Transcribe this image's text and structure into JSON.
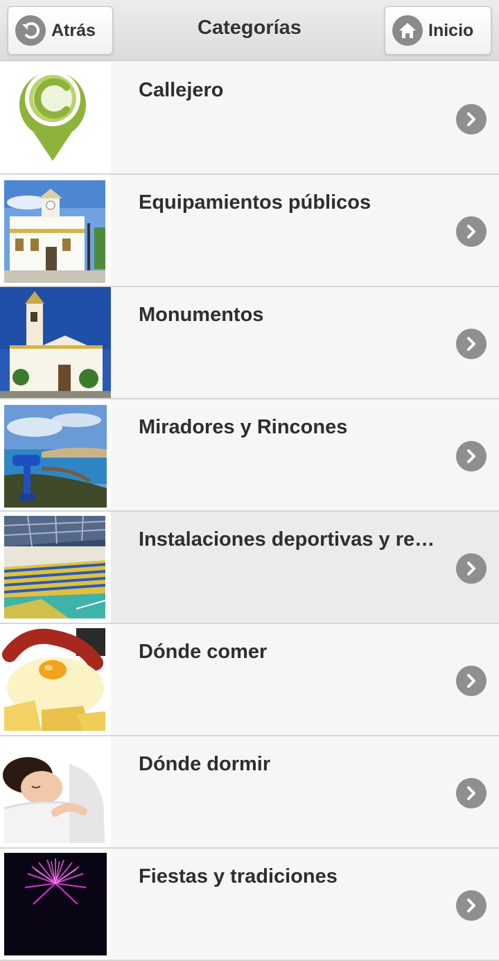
{
  "header": {
    "title": "Categorías",
    "back_label": "Atrás",
    "home_label": "Inicio"
  },
  "categories": [
    {
      "label": "Callejero",
      "thumb": "map-pin-c-logo"
    },
    {
      "label": "Equipamientos públicos",
      "thumb": "town-hall-photo"
    },
    {
      "label": "Monumentos",
      "thumb": "church-tower-photo"
    },
    {
      "label": "Miradores y Rincones",
      "thumb": "viewpoint-telescope-photo"
    },
    {
      "label": "Instalaciones deportivas y re…",
      "thumb": "sports-hall-photo"
    },
    {
      "label": "Dónde comer",
      "thumb": "food-eggs-chorizo-photo"
    },
    {
      "label": "Dónde dormir",
      "thumb": "sleeping-woman-photo"
    },
    {
      "label": "Fiestas y tradiciones",
      "thumb": "fireworks-photo"
    }
  ],
  "icons": {
    "back": "back-arrow-icon",
    "home": "home-icon",
    "chevron": "chevron-right-icon"
  },
  "colors": {
    "header_bg": "#e2e2e2",
    "row_bg": "#f6f6f6",
    "row_active_bg": "#ebebeb",
    "icon_gray": "#8f8f8f",
    "logo_green": "#8db33a"
  }
}
